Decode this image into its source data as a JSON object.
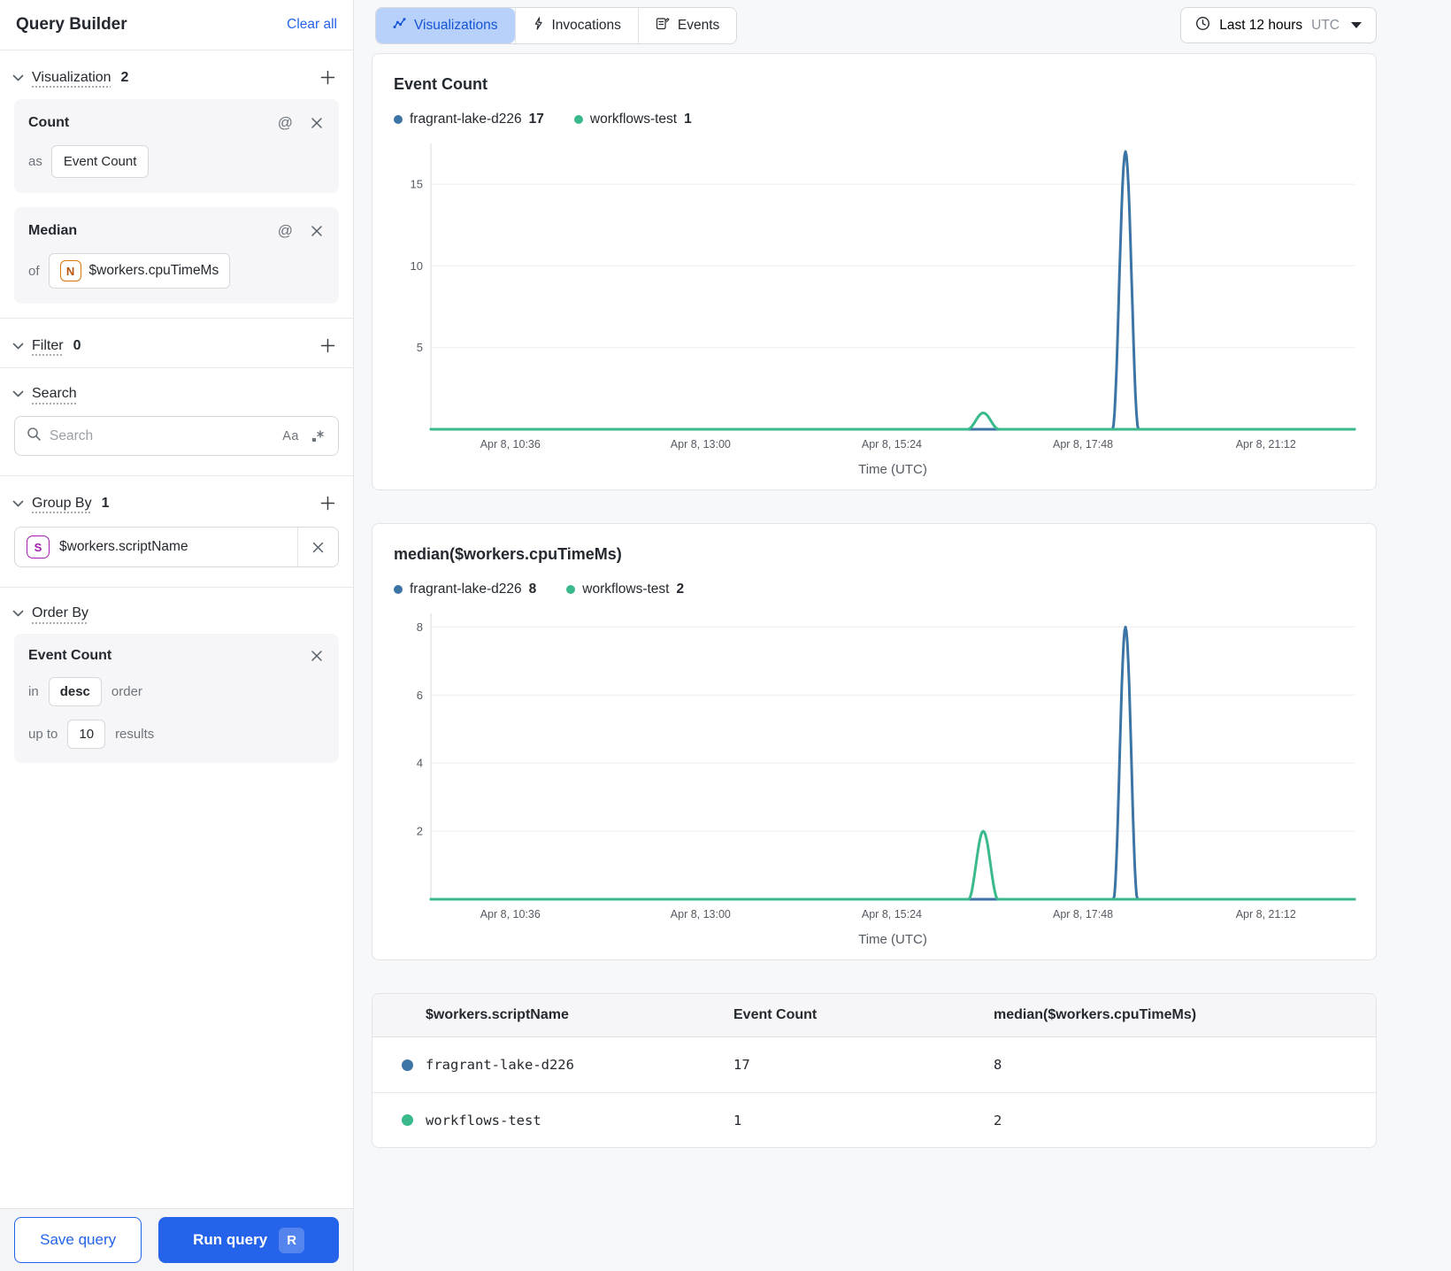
{
  "sidebar": {
    "title": "Query Builder",
    "clear_all": "Clear all",
    "visualization": {
      "label": "Visualization",
      "count": "2"
    },
    "count_card": {
      "title": "Count",
      "as_label": "as",
      "value": "Event Count"
    },
    "median_card": {
      "title": "Median",
      "of_label": "of",
      "field_icon": "N",
      "value": "$workers.cpuTimeMs"
    },
    "filter": {
      "label": "Filter",
      "count": "0"
    },
    "search": {
      "label": "Search",
      "placeholder": "Search",
      "case_icon": "Aa"
    },
    "group_by": {
      "label": "Group By",
      "count": "1",
      "item": {
        "icon": "S",
        "value": "$workers.scriptName"
      }
    },
    "order_by": {
      "label": "Order By",
      "field": "Event Count",
      "in_label": "in",
      "direction": "desc",
      "order_label": "order",
      "up_to_label": "up to",
      "limit": "10",
      "results_label": "results"
    },
    "footer": {
      "save": "Save query",
      "run": "Run query",
      "shortcut": "R"
    }
  },
  "topbar": {
    "tabs": [
      {
        "label": "Visualizations",
        "active": true
      },
      {
        "label": "Invocations",
        "active": false
      },
      {
        "label": "Events",
        "active": false
      }
    ],
    "time_range": {
      "label": "Last 12 hours",
      "timezone": "UTC"
    }
  },
  "chart_data": [
    {
      "type": "line",
      "title": "Event Count",
      "xlabel": "Time (UTC)",
      "ylim": [
        0,
        17.5
      ],
      "yticks": [
        5,
        10,
        15
      ],
      "xticks": [
        {
          "label": "Apr 8, 10:36",
          "f": 0.086
        },
        {
          "label": "Apr 8, 13:00",
          "f": 0.292
        },
        {
          "label": "Apr 8, 15:24",
          "f": 0.499
        },
        {
          "label": "Apr 8, 17:48",
          "f": 0.706
        },
        {
          "label": "Apr 8, 21:12",
          "f": 0.904
        }
      ],
      "series": [
        {
          "name": "fragrant-lake-d226",
          "color": "#3C74A6",
          "legend_value": "17",
          "spike": {
            "center": 0.752,
            "half": 0.014,
            "peak": 17
          }
        },
        {
          "name": "workflows-test",
          "color": "#3AB98A",
          "legend_value": "1",
          "spike": {
            "center": 0.598,
            "half": 0.017,
            "peak": 1
          }
        }
      ]
    },
    {
      "type": "line",
      "title": "median($workers.cpuTimeMs)",
      "xlabel": "Time (UTC)",
      "ylim": [
        0,
        8.4
      ],
      "yticks": [
        2,
        4,
        6,
        8
      ],
      "xticks": [
        {
          "label": "Apr 8, 10:36",
          "f": 0.086
        },
        {
          "label": "Apr 8, 13:00",
          "f": 0.292
        },
        {
          "label": "Apr 8, 15:24",
          "f": 0.499
        },
        {
          "label": "Apr 8, 17:48",
          "f": 0.706
        },
        {
          "label": "Apr 8, 21:12",
          "f": 0.904
        }
      ],
      "series": [
        {
          "name": "fragrant-lake-d226",
          "color": "#3C74A6",
          "legend_value": "8",
          "spike": {
            "center": 0.752,
            "half": 0.013,
            "peak": 8
          }
        },
        {
          "name": "workflows-test",
          "color": "#3AB98A",
          "legend_value": "2",
          "spike": {
            "center": 0.598,
            "half": 0.016,
            "peak": 2
          }
        }
      ]
    }
  ],
  "table": {
    "columns": [
      "$workers.scriptName",
      "Event Count",
      "median($workers.cpuTimeMs)"
    ],
    "rows": [
      {
        "color": "#3C74A6",
        "name": "fragrant-lake-d226",
        "event_count": "17",
        "median": "8"
      },
      {
        "color": "#3AB98A",
        "name": "workflows-test",
        "event_count": "1",
        "median": "2"
      }
    ]
  }
}
